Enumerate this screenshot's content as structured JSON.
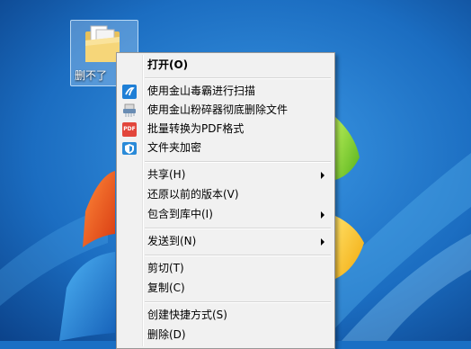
{
  "desktop": {
    "icon_label": "删不了"
  },
  "context_menu": {
    "items": [
      {
        "label": "打开(O)",
        "bold": true
      },
      {
        "label": "使用金山毒霸进行扫描",
        "icon": "kingsoft-antivirus-icon"
      },
      {
        "label": "使用金山粉碎器彻底删除文件",
        "icon": "shredder-icon"
      },
      {
        "label": "批量转换为PDF格式",
        "icon": "pdf-icon"
      },
      {
        "label": "文件夹加密",
        "icon": "folder-encrypt-icon"
      },
      {
        "label": "共享(H)",
        "submenu": true
      },
      {
        "label": "还原以前的版本(V)"
      },
      {
        "label": "包含到库中(I)",
        "submenu": true
      },
      {
        "label": "发送到(N)",
        "submenu": true
      },
      {
        "label": "剪切(T)"
      },
      {
        "label": "复制(C)"
      },
      {
        "label": "创建快捷方式(S)"
      },
      {
        "label": "删除(D)"
      }
    ],
    "pdf_icon_text": "PDF"
  },
  "colors": {
    "desktop_blue": "#1a6fc4",
    "menu_bg": "#f1f1f1",
    "arrow_red": "#d8262a"
  }
}
